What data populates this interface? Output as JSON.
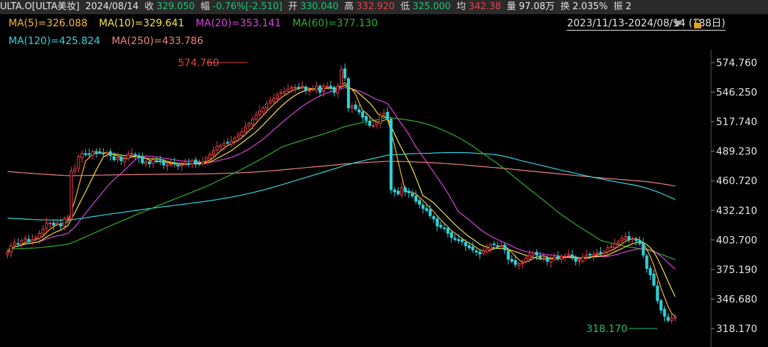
{
  "header": {
    "symbol": "ULTA.O[ULTA美妆]",
    "date": "2024/08/14",
    "close_label": "收",
    "close": "329.050",
    "change_label": "幅",
    "change": "-0.76%[-2.510]",
    "open_label": "开",
    "open": "330.040",
    "high_label": "高",
    "high": "332.920",
    "low_label": "低",
    "low": "325.000",
    "avg_label": "均",
    "avg": "342.38",
    "vol_label": "量",
    "vol": "97.08万",
    "turnover_label": "换",
    "turnover": "2.035%",
    "amp_label": "振",
    "amp": "2"
  },
  "ma_labels": {
    "ma5": "MA(5)=326.088",
    "ma10": "MA(10)=329.641",
    "ma20": "MA(20)=353.141",
    "ma60": "MA(60)=377.130",
    "ma120": "MA(120)=425.824",
    "ma250": "MA(250)=433.786"
  },
  "date_range": "2023/11/13-2024/08/14 (188日)",
  "colors": {
    "up": "#e8404a",
    "down": "#2fd0d6",
    "ma5": "#ffb833",
    "ma10": "#f5e640",
    "ma20": "#e040e0",
    "ma60": "#30b030",
    "ma120": "#30d8e0",
    "ma250": "#f08080"
  },
  "chart_data": {
    "type": "candlestick",
    "ylim": [
      318.17,
      574.76
    ],
    "yticks": [
      "574.760",
      "546.250",
      "517.740",
      "489.230",
      "460.720",
      "432.210",
      "403.700",
      "375.190",
      "346.680",
      "318.170"
    ],
    "annotations": [
      {
        "text": "574.760",
        "x": 68,
        "y": 574.76
      },
      {
        "text": "318.170",
        "x": 183,
        "y": 318.17
      }
    ],
    "close": [
      392,
      398,
      401,
      400,
      403,
      405,
      402,
      404,
      406,
      410,
      414,
      420,
      420,
      418,
      420,
      417,
      424,
      425,
      470,
      472,
      484,
      487,
      486,
      486,
      489,
      488,
      488,
      487,
      488,
      485,
      481,
      483,
      480,
      482,
      486,
      487,
      485,
      483,
      478,
      479,
      477,
      481,
      480,
      479,
      476,
      476,
      477,
      477,
      475,
      476,
      478,
      477,
      480,
      478,
      477,
      479,
      483,
      486,
      490,
      494,
      495,
      497,
      497,
      499,
      502,
      505,
      508,
      513,
      516,
      520,
      524,
      528,
      531,
      535,
      538,
      540,
      544,
      546,
      547,
      549,
      551,
      551,
      550,
      552,
      548,
      548,
      549,
      552,
      546,
      552,
      552,
      550,
      546,
      552,
      568,
      560,
      531,
      533,
      530,
      527,
      522,
      519,
      514,
      514,
      517,
      524,
      526,
      521,
      452,
      450,
      448,
      454,
      450,
      449,
      446,
      441,
      438,
      434,
      432,
      427,
      424,
      417,
      416,
      415,
      410,
      406,
      404,
      403,
      402,
      398,
      396,
      394,
      392,
      390,
      393,
      395,
      399,
      399,
      398,
      398,
      394,
      385,
      383,
      380,
      381,
      382,
      386,
      389,
      391,
      389,
      386,
      386,
      383,
      385,
      387,
      386,
      388,
      388,
      390,
      387,
      383,
      384,
      387,
      389,
      389,
      390,
      391,
      391,
      392,
      396,
      397,
      400,
      402,
      405,
      407,
      404,
      405,
      403,
      400,
      389,
      376,
      370,
      360,
      345,
      336,
      330,
      326,
      328,
      329
    ]
  }
}
